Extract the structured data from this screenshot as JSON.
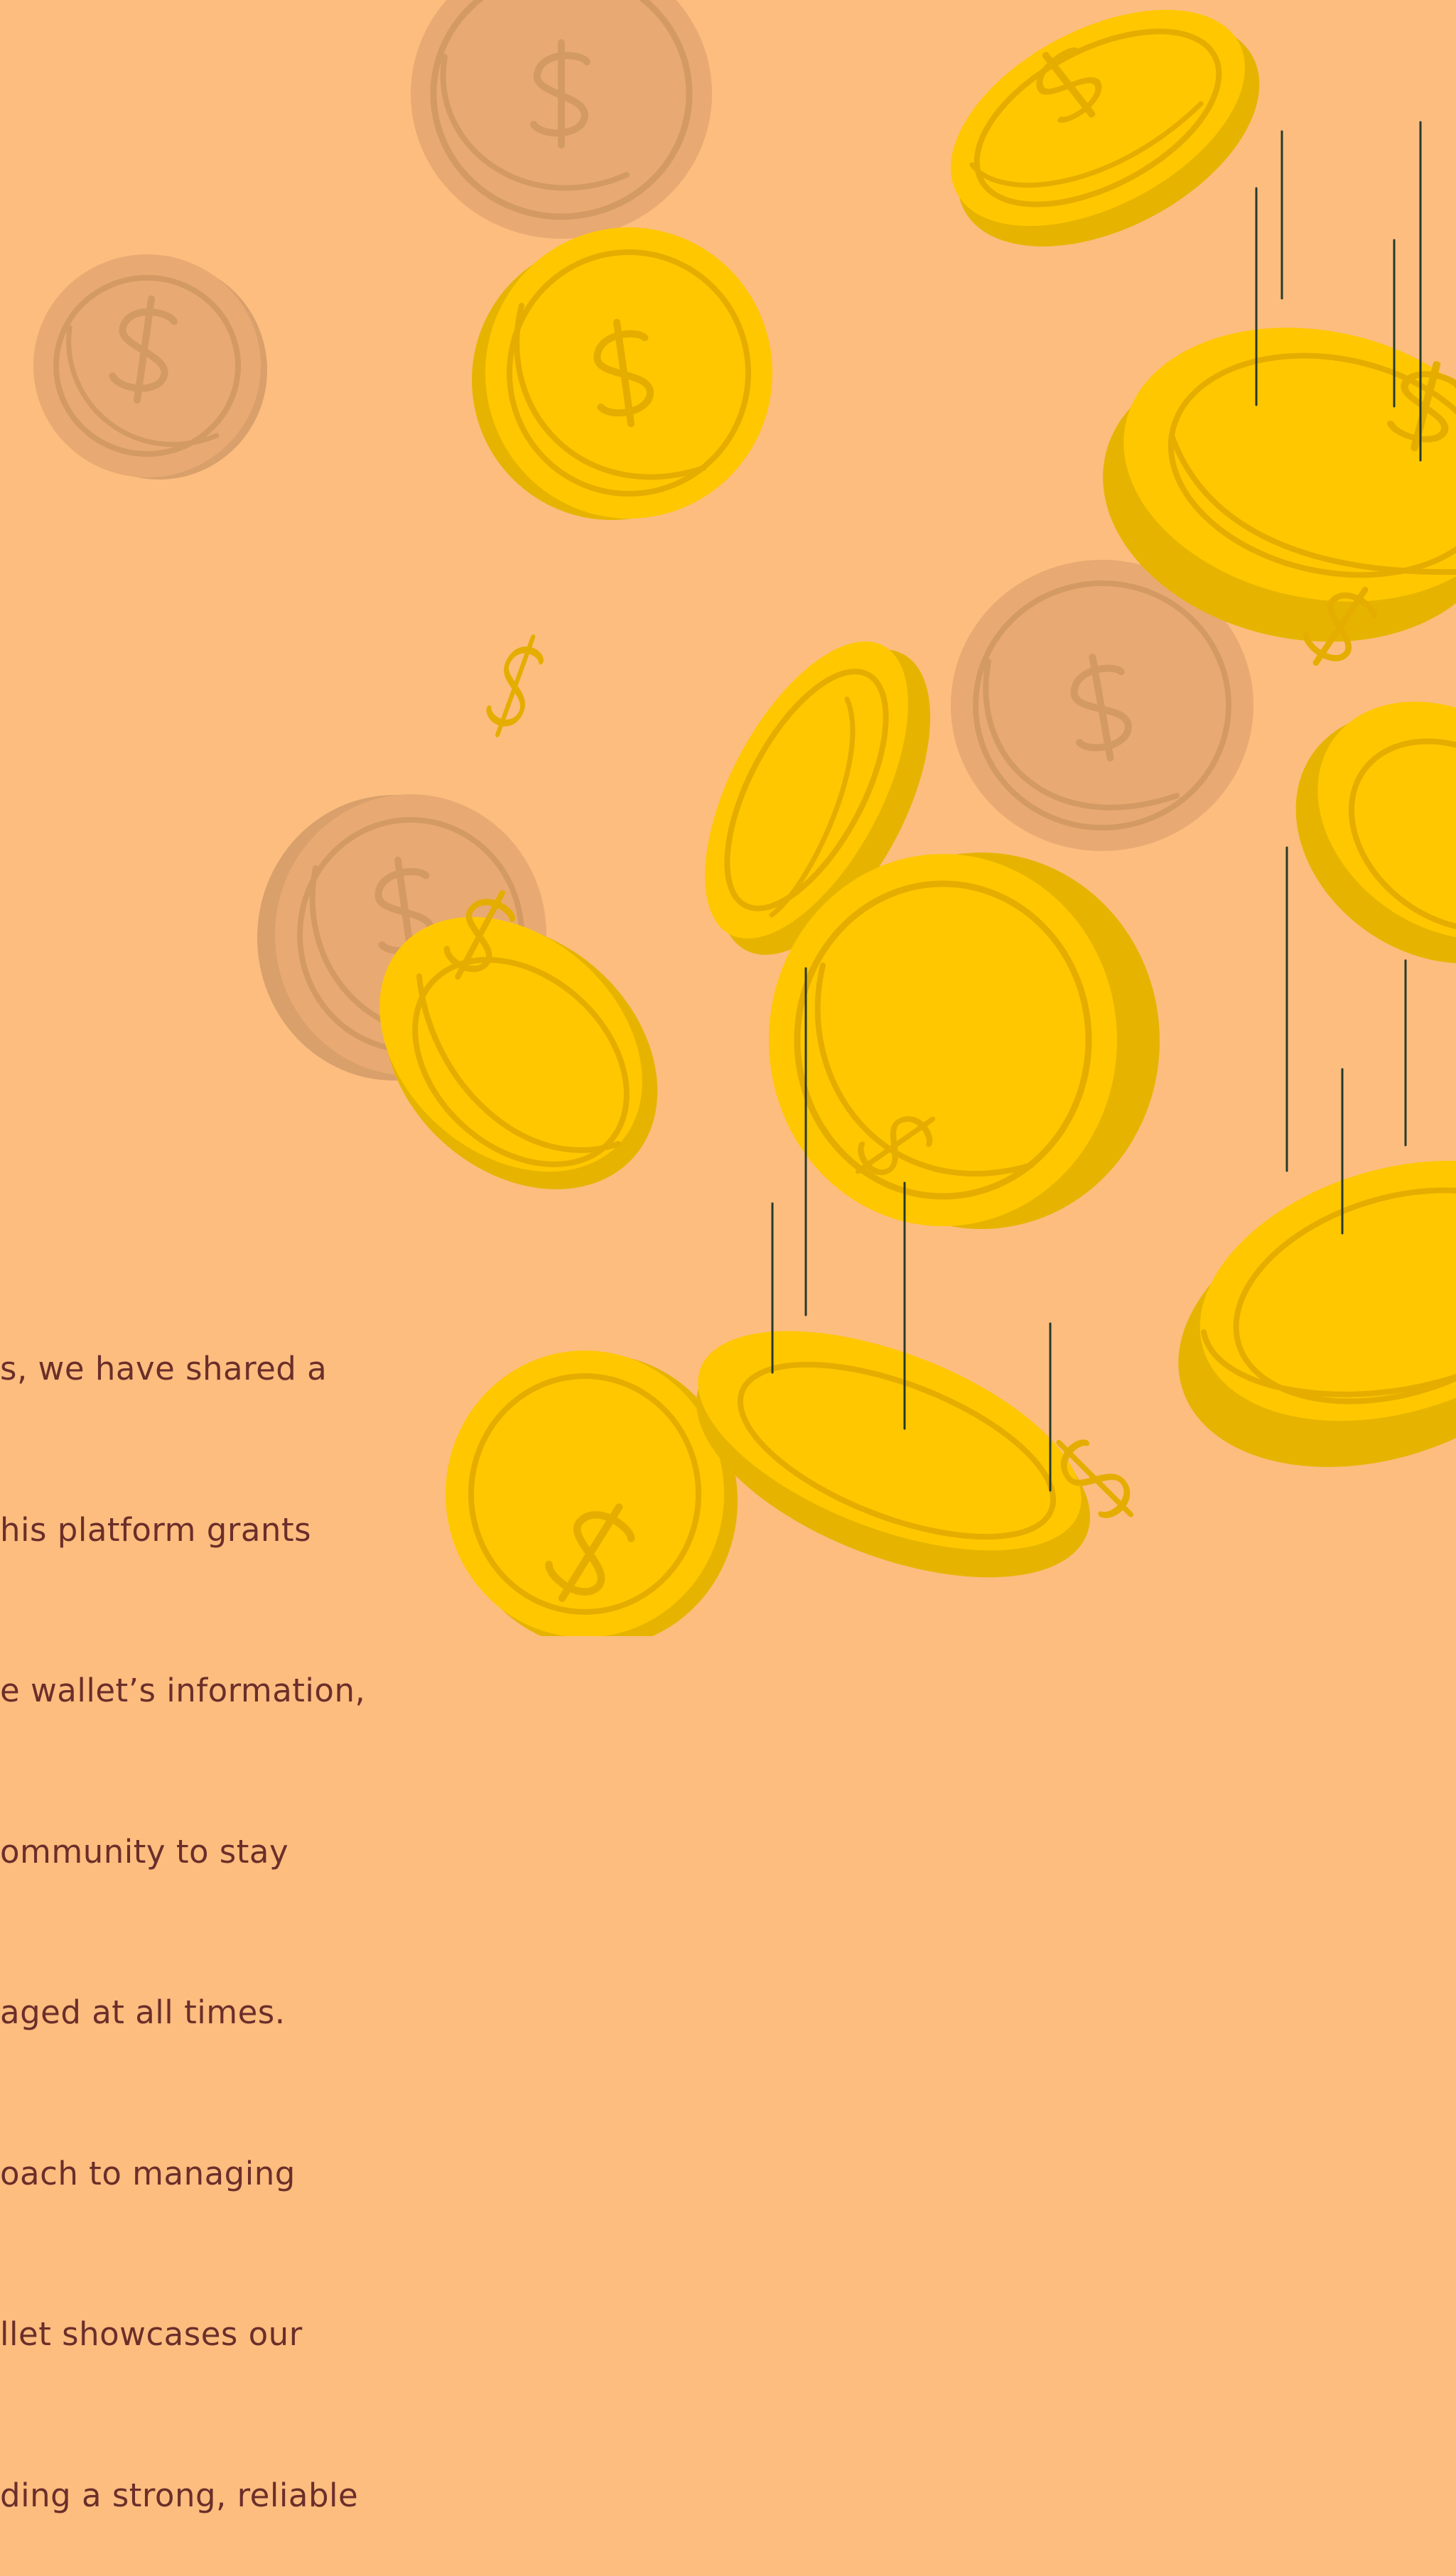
{
  "theme": {
    "background": "#FCBD7F",
    "text_color": "#6B2E2A",
    "coin_face": "#FFC700",
    "coin_edge": "#E6B400",
    "coin_mark": "#E5AD00",
    "faded_face": "#E8AA72",
    "faded_edge": "#D9A06B",
    "faded_mark": "#D49A63",
    "motion_line": "#263A2E"
  },
  "illustration": {
    "coin_symbol": "$",
    "coins": [
      {
        "name": "faded-coin-top",
        "kind": "faded"
      },
      {
        "name": "faded-coin-left",
        "kind": "faded"
      },
      {
        "name": "faded-coin-middle-right",
        "kind": "faded"
      },
      {
        "name": "faded-coin-lower-left",
        "kind": "faded"
      },
      {
        "name": "gold-coin-top-right",
        "kind": "gold"
      },
      {
        "name": "gold-coin-upper-middle",
        "kind": "gold"
      },
      {
        "name": "gold-coin-right-large",
        "kind": "gold"
      },
      {
        "name": "gold-coin-middle-tilted",
        "kind": "gold"
      },
      {
        "name": "gold-coin-center",
        "kind": "gold"
      },
      {
        "name": "gold-coin-left-tilted",
        "kind": "gold"
      },
      {
        "name": "gold-coin-bottom-left",
        "kind": "gold"
      },
      {
        "name": "gold-coin-bottom-middle",
        "kind": "gold"
      },
      {
        "name": "gold-coin-right-lower",
        "kind": "gold"
      },
      {
        "name": "gold-coin-bottom-right",
        "kind": "gold"
      }
    ]
  },
  "text_block": {
    "lines": [
      "s, we have shared a",
      "his platform grants",
      "e wallet’s information,",
      "ommunity to stay",
      "aged at all times.",
      "oach to managing",
      "llet showcases our",
      "ding a strong, reliable"
    ]
  }
}
